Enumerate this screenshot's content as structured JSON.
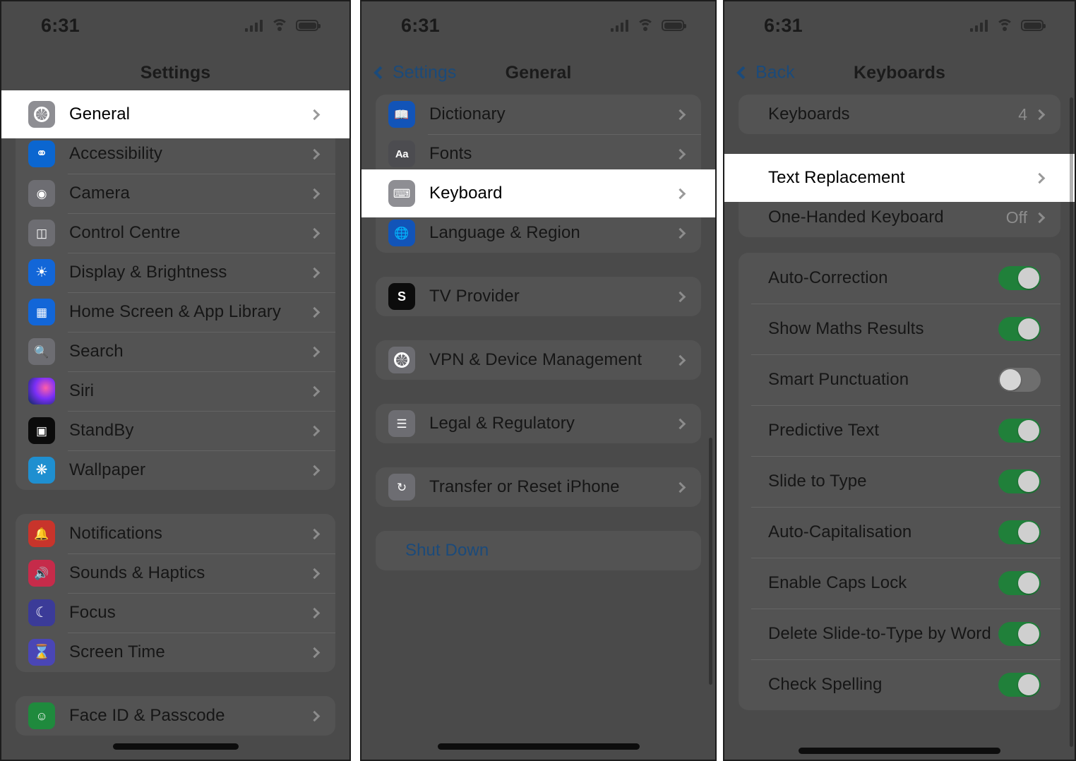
{
  "statusbar": {
    "time": "6:31"
  },
  "panel1": {
    "nav": {
      "title": "Settings"
    },
    "groups": [
      {
        "rows": [
          {
            "label": "General",
            "icon": "gear-icon",
            "highlighted": true
          },
          {
            "label": "Accessibility",
            "icon": "accessibility-icon"
          },
          {
            "label": "Camera",
            "icon": "camera-icon"
          },
          {
            "label": "Control Centre",
            "icon": "control-centre-icon"
          },
          {
            "label": "Display & Brightness",
            "icon": "display-brightness-icon"
          },
          {
            "label": "Home Screen & App Library",
            "icon": "home-screen-icon"
          },
          {
            "label": "Search",
            "icon": "search-icon"
          },
          {
            "label": "Siri",
            "icon": "siri-icon"
          },
          {
            "label": "StandBy",
            "icon": "standby-icon"
          },
          {
            "label": "Wallpaper",
            "icon": "wallpaper-icon"
          }
        ]
      },
      {
        "rows": [
          {
            "label": "Notifications",
            "icon": "notifications-icon"
          },
          {
            "label": "Sounds & Haptics",
            "icon": "sounds-haptics-icon"
          },
          {
            "label": "Focus",
            "icon": "focus-icon"
          },
          {
            "label": "Screen Time",
            "icon": "screen-time-icon"
          }
        ]
      },
      {
        "rows": [
          {
            "label": "Face ID & Passcode",
            "icon": "face-id-icon"
          }
        ]
      }
    ]
  },
  "panel2": {
    "nav": {
      "back": "Settings",
      "title": "General"
    },
    "groups": [
      {
        "rows": [
          {
            "label": "Dictionary",
            "icon": "dictionary-icon"
          },
          {
            "label": "Fonts",
            "icon": "fonts-icon"
          },
          {
            "label": "Keyboard",
            "icon": "keyboard-icon",
            "highlighted": true
          },
          {
            "label": "Language & Region",
            "icon": "language-region-icon"
          }
        ]
      },
      {
        "rows": [
          {
            "label": "TV Provider",
            "icon": "tv-provider-icon"
          }
        ]
      },
      {
        "rows": [
          {
            "label": "VPN & Device Management",
            "icon": "vpn-device-management-icon"
          }
        ]
      },
      {
        "rows": [
          {
            "label": "Legal & Regulatory",
            "icon": "legal-regulatory-icon"
          }
        ]
      },
      {
        "rows": [
          {
            "label": "Transfer or Reset iPhone",
            "icon": "transfer-reset-icon"
          }
        ]
      },
      {
        "rows": [
          {
            "label": "Shut Down",
            "style": "blue"
          }
        ]
      }
    ]
  },
  "panel3": {
    "nav": {
      "back": "Back",
      "title": "Keyboards"
    },
    "groups": [
      {
        "rows": [
          {
            "label": "Keyboards",
            "value": "4"
          }
        ]
      },
      {
        "rows": [
          {
            "label": "Text Replacement",
            "highlighted": true
          },
          {
            "label": "One-Handed Keyboard",
            "value": "Off"
          }
        ]
      },
      {
        "rows": [
          {
            "label": "Auto-Correction",
            "toggle": "on"
          },
          {
            "label": "Show Maths Results",
            "toggle": "on"
          },
          {
            "label": "Smart Punctuation",
            "toggle": "off"
          },
          {
            "label": "Predictive Text",
            "toggle": "on"
          },
          {
            "label": "Slide to Type",
            "toggle": "on"
          },
          {
            "label": "Auto-Capitalisation",
            "toggle": "on"
          },
          {
            "label": "Enable Caps Lock",
            "toggle": "on"
          },
          {
            "label": "Delete Slide-to-Type by Word",
            "toggle": "on"
          },
          {
            "label": "Check Spelling",
            "toggle": "on"
          }
        ]
      }
    ]
  },
  "colors": {
    "toggle_on": "#20803a",
    "link_blue": "#1b4a7a",
    "dim_background": "#4a4a4a"
  }
}
